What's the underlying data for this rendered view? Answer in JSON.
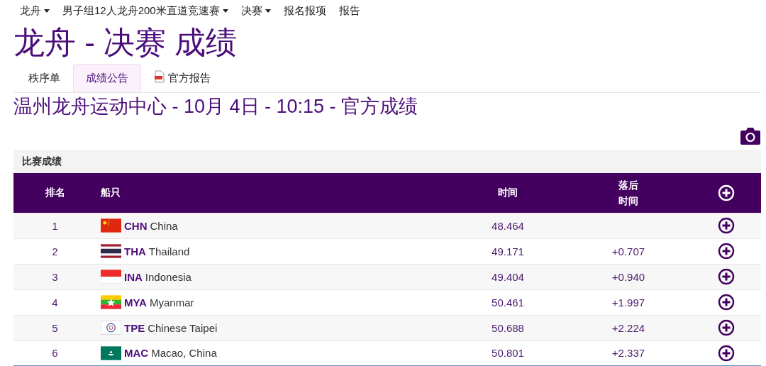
{
  "nav": [
    {
      "label": "龙舟",
      "dropdown": true
    },
    {
      "label": "男子组12人龙舟200米直道竞速赛",
      "dropdown": true
    },
    {
      "label": "决赛",
      "dropdown": true
    },
    {
      "label": "报名报项",
      "dropdown": false
    },
    {
      "label": "报告",
      "dropdown": false
    }
  ],
  "title": "龙舟 - 决赛 成绩",
  "tabs": [
    {
      "label": "秩序单",
      "selected": false,
      "pdf": false
    },
    {
      "label": "成绩公告",
      "selected": true,
      "pdf": false
    },
    {
      "label": "官方报告",
      "selected": false,
      "pdf": true
    }
  ],
  "subtitle": "温州龙舟运动中心 - 10月 4日 - 10:15 - 官方成绩",
  "panel": {
    "title": "比赛成绩"
  },
  "table": {
    "columns": [
      "排名",
      "船只",
      "时间",
      "落后时间"
    ],
    "rows": [
      {
        "rank": "1",
        "kind": "chn",
        "code": "CHN",
        "name": "China",
        "time": "48.464"
      },
      {
        "rank": "2",
        "kind": "tha",
        "code": "THA",
        "name": "Thailand",
        "time": "49.171",
        "behind": "+0.707"
      },
      {
        "rank": "3",
        "kind": "ina",
        "code": "INA",
        "name": "Indonesia",
        "time": "49.404",
        "behind": "+0.940"
      },
      {
        "rank": "4",
        "kind": "mya",
        "code": "MYA",
        "name": "Myanmar",
        "time": "50.461",
        "behind": "+1.997"
      },
      {
        "rank": "5",
        "kind": "tpe",
        "code": "TPE",
        "name": "Chinese Taipei",
        "time": "50.688",
        "behind": "+2.224"
      },
      {
        "rank": "6",
        "kind": "mac",
        "code": "MAC",
        "name": "Macao, China",
        "time": "50.801",
        "behind": "+2.337"
      }
    ]
  }
}
